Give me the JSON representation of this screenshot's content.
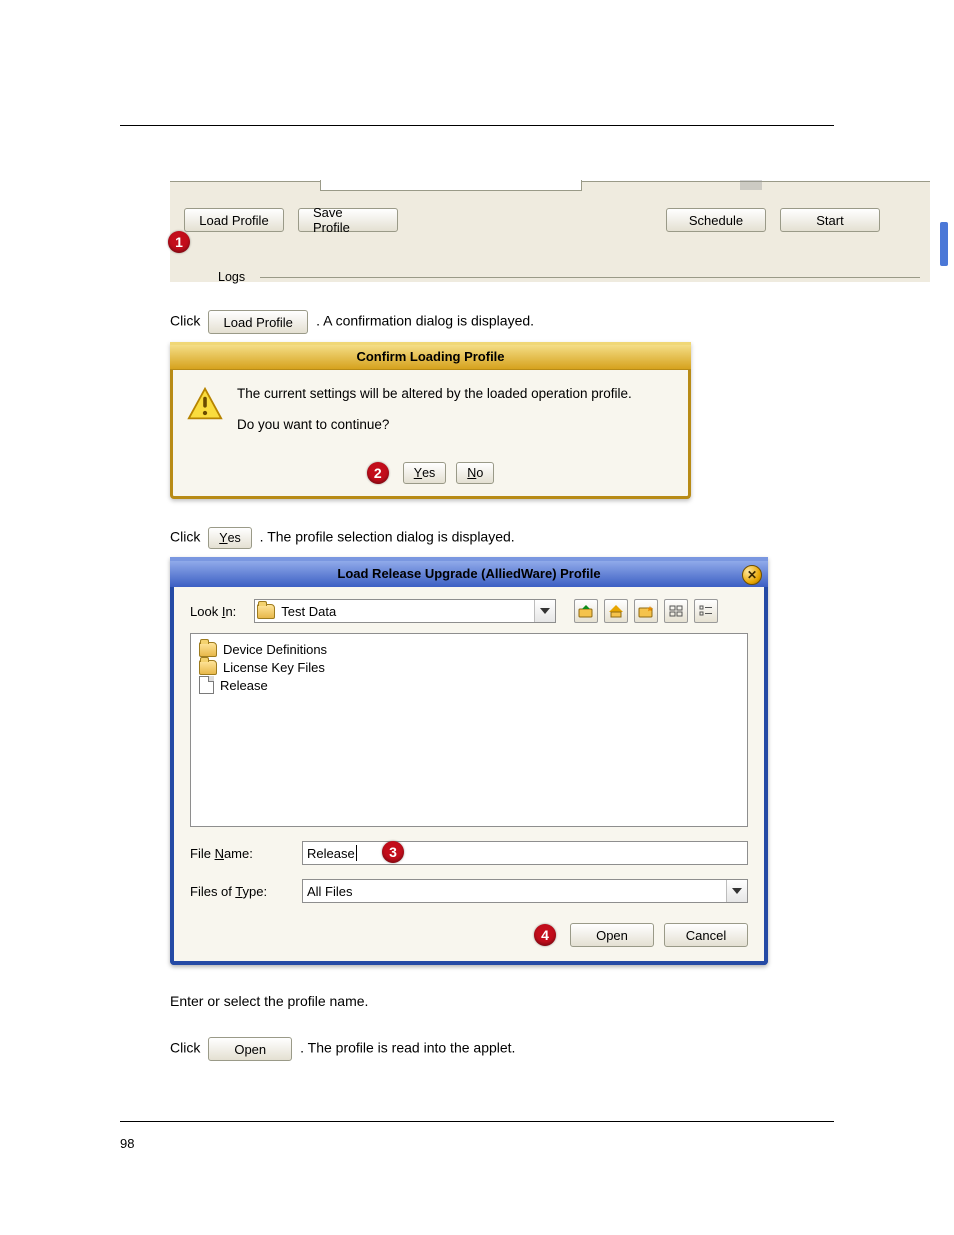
{
  "strip": {
    "load_profile": "Load Profile",
    "save_profile": "Save Profile",
    "schedule": "Schedule",
    "start": "Start",
    "logs_label": "Logs"
  },
  "step1": {
    "badge": "1",
    "prefix": "Click",
    "suffix": ". A confirmation dialog is displayed.",
    "btn": "Load Profile"
  },
  "confirm": {
    "title": "Confirm Loading Profile",
    "line1": "The current settings will be altered by the loaded operation profile.",
    "line2": "Do you want to continue?",
    "yes": "Yes",
    "no": "No"
  },
  "step2": {
    "badge": "2",
    "prefix": "Click",
    "suffix": ". The profile selection dialog is displayed.",
    "btn": "Yes"
  },
  "file": {
    "title": "Load Release Upgrade (AlliedWare) Profile",
    "look_in_label": "Look In:",
    "look_in_value": "Test Data",
    "items": [
      {
        "type": "folder",
        "name": "Device Definitions"
      },
      {
        "type": "folder",
        "name": "License Key Files"
      },
      {
        "type": "file",
        "name": "Release"
      }
    ],
    "file_name_label": "File Name:",
    "file_name_value": "Release",
    "files_type_label": "Files of Type:",
    "files_type_value": "All Files",
    "open": "Open",
    "cancel": "Cancel"
  },
  "step3": {
    "badge": "3",
    "text": "Enter or select the profile name."
  },
  "step4": {
    "badge": "4",
    "prefix": "Click",
    "suffix": ". The profile is read into the applet.",
    "btn": "Open"
  },
  "pagenum": "98"
}
